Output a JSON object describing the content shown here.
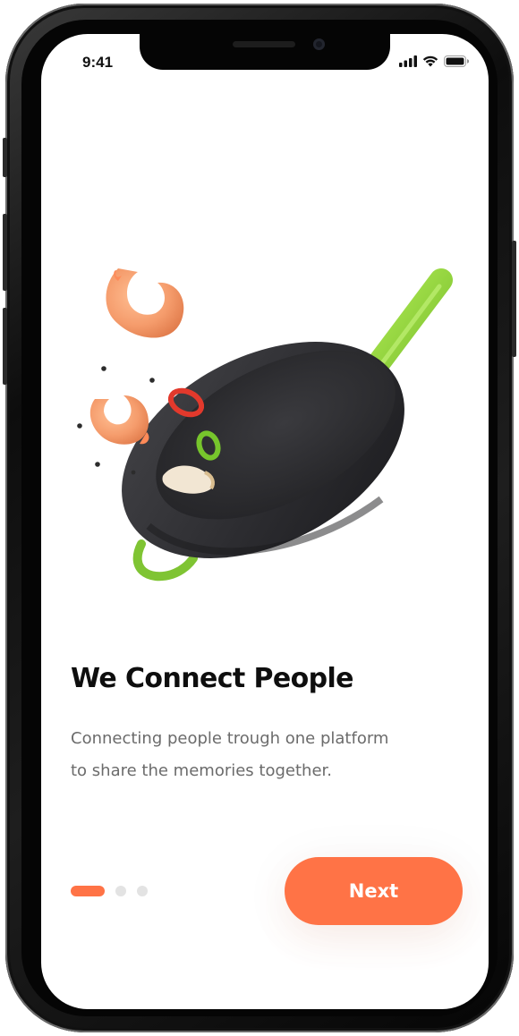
{
  "status_bar": {
    "time": "9:41",
    "icons": [
      "signal-icon",
      "wifi-icon",
      "battery-icon"
    ]
  },
  "onboarding": {
    "illustration": "wok-with-shrimp-illustration",
    "title": "We Connect People",
    "description_line1": "Connecting people trough one platform",
    "description_line2": "to share the memories together.",
    "pager": {
      "total": 3,
      "active_index": 0
    },
    "next_button_label": "Next"
  },
  "colors": {
    "accent": "#ff7346",
    "title": "#0e0e0e",
    "body_text": "#6b6b6b",
    "inactive_dot": "#e3e3e3",
    "wok": "#2f2f33",
    "handle": "#8ed23a",
    "shrimp": "#f59c6c"
  }
}
